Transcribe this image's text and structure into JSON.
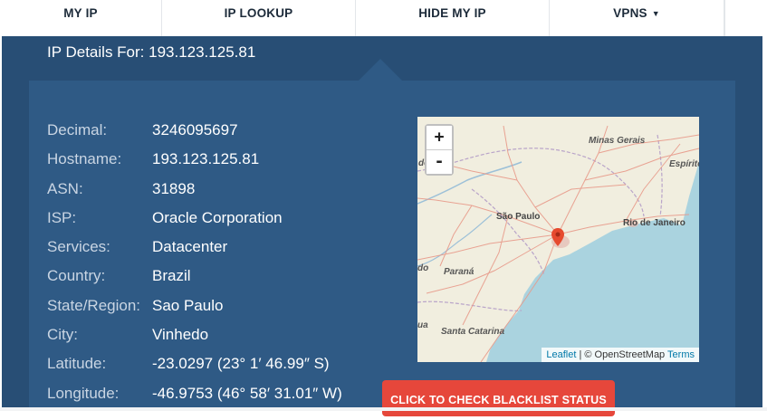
{
  "nav": {
    "items": [
      {
        "label": "MY IP"
      },
      {
        "label": "IP LOOKUP"
      },
      {
        "label": "HIDE MY IP"
      },
      {
        "label": "VPNS",
        "has_dropdown": true,
        "caret": "▼"
      }
    ]
  },
  "details": {
    "title": "IP Details For: 193.123.125.81",
    "rows": [
      {
        "label": "Decimal:",
        "value": "3246095697"
      },
      {
        "label": "Hostname:",
        "value": "193.123.125.81"
      },
      {
        "label": "ASN:",
        "value": "31898"
      },
      {
        "label": "ISP:",
        "value": "Oracle Corporation"
      },
      {
        "label": "Services:",
        "value": "Datacenter"
      },
      {
        "label": "Country:",
        "value": "Brazil"
      },
      {
        "label": "State/Region:",
        "value": "Sao Paulo"
      },
      {
        "label": "City:",
        "value": "Vinhedo"
      },
      {
        "label": "Latitude:",
        "value": "-23.0297 (23° 1′ 46.99″ S)"
      },
      {
        "label": "Longitude:",
        "value": "-46.9753 (46° 58′ 31.01″ W)"
      }
    ]
  },
  "map": {
    "zoom_in": "+",
    "zoom_out": "-",
    "labels": {
      "minas": "Minas Gerais",
      "espirito": "Espírito",
      "sao_paulo": "São Paulo",
      "rio": "Rio de Janeiro",
      "parana": "Paraná",
      "santa_catarina": "Santa Catarina",
      "edge_de": "de",
      "edge_do": "do",
      "edge_ua": "ua"
    },
    "attribution": {
      "leaflet": "Leaflet",
      "separator": " | © OpenStreetMap ",
      "terms": "Terms"
    },
    "colors": {
      "land": "#f1eedf",
      "ocean": "#aad3df",
      "roads": "#e89a8a",
      "marker": "#e64a2e"
    }
  },
  "blacklist_button": {
    "label": "CLICK TO CHECK BLACKLIST STATUS"
  },
  "colors": {
    "panel": "#284e75",
    "card": "#2f5a85",
    "button": "#e6473b"
  }
}
